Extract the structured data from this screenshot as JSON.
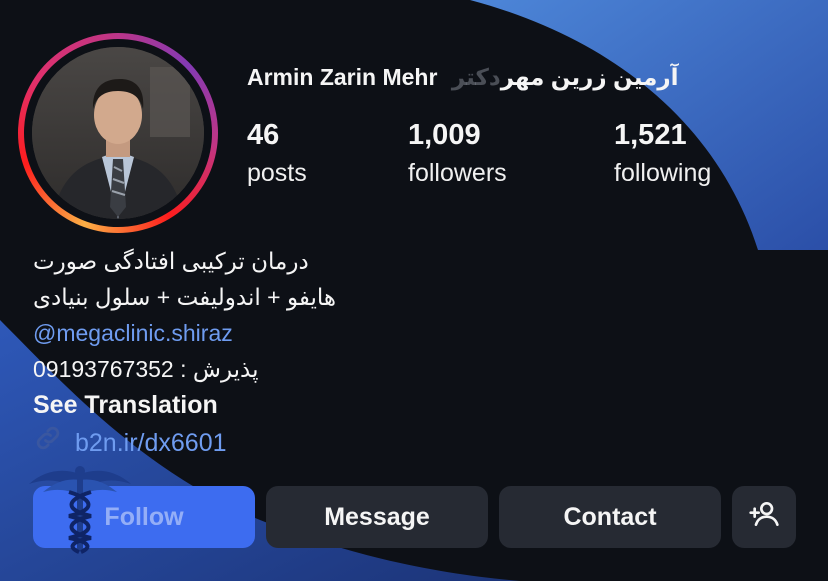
{
  "profile": {
    "name": "Armin Zarin Mehr آرمین زرین مهر",
    "name_overlay": "دکتر",
    "stats": {
      "posts": {
        "value": "46",
        "label": "posts"
      },
      "followers": {
        "value": "1,009",
        "label": "followers"
      },
      "following": {
        "value": "1,521",
        "label": "following"
      }
    }
  },
  "bio": {
    "line1": "درمان ترکیبی افتادگی صورت",
    "line2": "هایفو + اندولیفت + سلول بنیادی",
    "handle": "@megaclinic.shiraz",
    "phone": "09193767352 : پذیرش",
    "translation": "See Translation",
    "link": "b2n.ir/dx6601"
  },
  "buttons": {
    "follow": "Follow",
    "message": "Message",
    "contact": "Contact"
  },
  "colors": {
    "background": "#0d1016",
    "accent_blue": "#3d6cf0",
    "link_blue": "#6f9cf0",
    "button_gray": "#262a33",
    "swoosh_blue": "#3a67c2"
  },
  "icons": {
    "link": "link-icon",
    "add_person": "add-person-icon",
    "caduceus": "caduceus-icon"
  }
}
